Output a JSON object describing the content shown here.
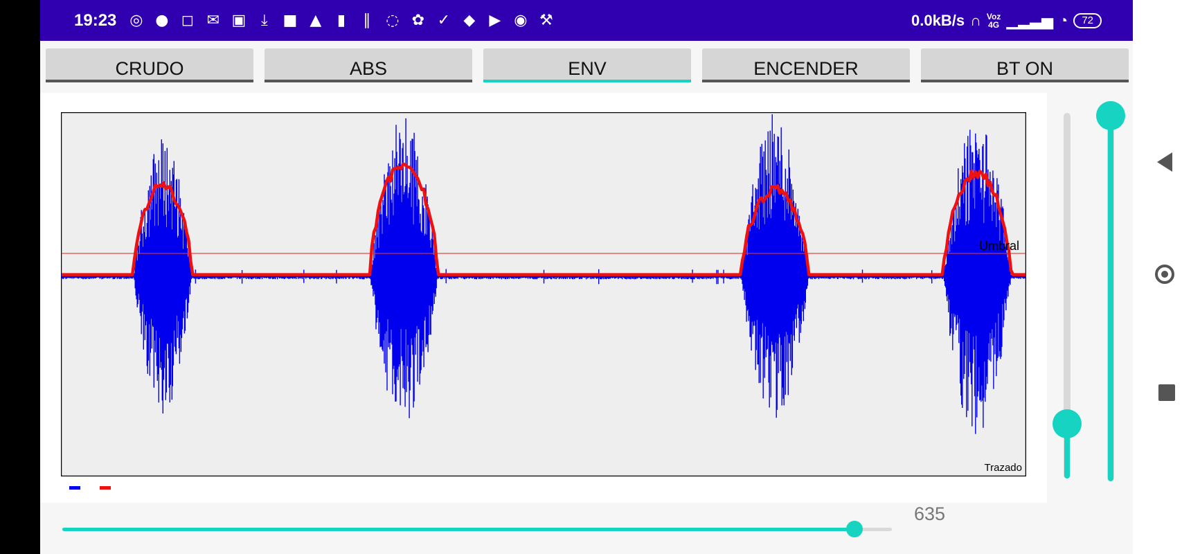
{
  "status_bar": {
    "time": "19:23",
    "notification_icons": [
      "whatsapp-icon",
      "facebook-icon",
      "instagram-icon",
      "gmail-icon",
      "linkedin-icon",
      "download-icon",
      "video-icon",
      "drive-icon",
      "netflix-icon",
      "app-icon",
      "app-icon-2",
      "app-icon-3",
      "check-icon",
      "twitter-icon",
      "youtube-icon",
      "app-icon-4",
      "wrench-icon"
    ],
    "net_speed": "0.0kB/s",
    "voz_top": "Voz",
    "voz_bottom": "4G",
    "battery": "72",
    "background": "#3000b0"
  },
  "tabs": [
    {
      "label": "CRUDO",
      "active": false
    },
    {
      "label": "ABS",
      "active": false
    },
    {
      "label": "ENV",
      "active": true
    },
    {
      "label": "ENCENDER",
      "active": false
    },
    {
      "label": "BT ON",
      "active": false
    }
  ],
  "chart": {
    "threshold_label": "Umbral",
    "corner_label": "Trazado"
  },
  "chart_data": {
    "type": "line",
    "title": "",
    "xlabel": "",
    "ylabel": "",
    "grid": false,
    "legend": "bottom-left",
    "ylim": [
      -1,
      1
    ],
    "threshold": 0.14,
    "bursts": [
      {
        "center": 0.105,
        "width": 0.06,
        "peak": 0.55,
        "amplitude_up": 0.86,
        "amplitude_down": 0.86
      },
      {
        "center": 0.355,
        "width": 0.07,
        "peak": 0.68,
        "amplitude_up": 0.98,
        "amplitude_down": 0.92
      },
      {
        "center": 0.74,
        "width": 0.07,
        "peak": 0.52,
        "amplitude_up": 1.0,
        "amplitude_down": 0.88
      },
      {
        "center": 0.95,
        "width": 0.07,
        "peak": 0.62,
        "amplitude_up": 0.96,
        "amplitude_down": 1.0
      }
    ],
    "series": [
      {
        "color": "#0000ee"
      },
      {
        "color": "#ee1111"
      }
    ],
    "threshold_color": "#ee3333",
    "background": "#eeeeee"
  },
  "sliders": {
    "horizontal_value": "635",
    "horizontal_fraction": 0.955,
    "vertical_left_fraction": 0.15,
    "vertical_right_fraction": 1.0,
    "accent": "#17d4c2"
  },
  "navbar": {
    "back": "back-icon",
    "home": "home-icon",
    "recent": "recent-apps-icon"
  }
}
